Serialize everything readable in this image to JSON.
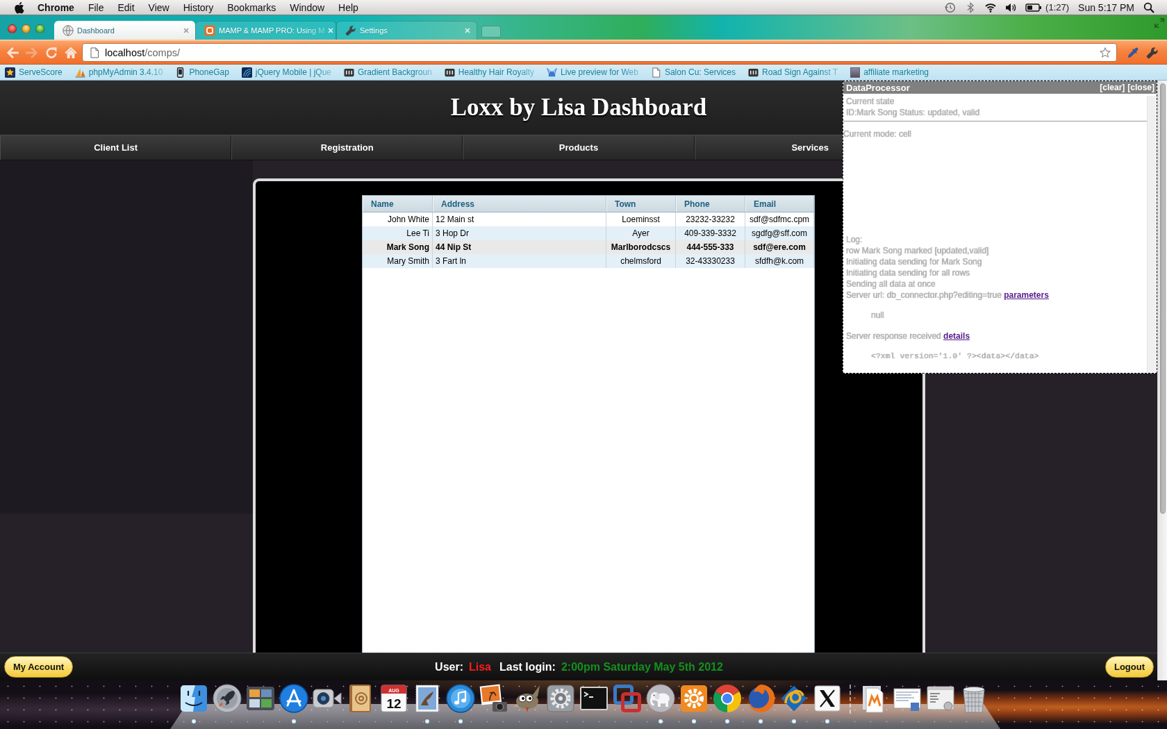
{
  "menu_bar": {
    "app_name": "Chrome",
    "menus": [
      "File",
      "Edit",
      "View",
      "History",
      "Bookmarks",
      "Window",
      "Help"
    ],
    "battery_time": "(1:27)",
    "clock": "Sun 5:17 PM"
  },
  "browser": {
    "tabs": [
      {
        "kind": "page",
        "title": "Dashboard",
        "selected": true,
        "truncated": false
      },
      {
        "kind": "blog",
        "title": "MAMP & MAMP PRO: Using M",
        "selected": false,
        "truncated": true
      },
      {
        "kind": "settings",
        "title": "Settings",
        "selected": false,
        "truncated": false
      }
    ],
    "nav_buttons": [
      {
        "kind": "back",
        "disabled": false
      },
      {
        "kind": "forward",
        "disabled": true
      },
      {
        "kind": "reload",
        "disabled": false
      },
      {
        "kind": "home",
        "disabled": false
      }
    ],
    "url": {
      "host": "localhost",
      "path": "/comps/"
    },
    "bookmarks": [
      {
        "kind": "star",
        "label": "ServeScore",
        "truncated": false
      },
      {
        "kind": "sail",
        "label": "phpMyAdmin 3.4.10",
        "truncated": true
      },
      {
        "kind": "phone",
        "label": "PhoneGap",
        "truncated": false
      },
      {
        "kind": "swirl",
        "label": "jQuery Mobile | jQue",
        "truncated": true
      },
      {
        "kind": "tile",
        "label": "Gradient Backgroun",
        "truncated": true
      },
      {
        "kind": "tile",
        "label": "Healthy Hair Royalty",
        "truncated": true
      },
      {
        "kind": "helmet",
        "label": "Live preview for Web",
        "truncated": true
      },
      {
        "kind": "page",
        "label": "Salon Cu: Services",
        "truncated": false
      },
      {
        "kind": "tile",
        "label": "Road Sign Against T",
        "truncated": true
      },
      {
        "kind": "photo",
        "label": "affiliate marketing",
        "truncated": false
      }
    ]
  },
  "page": {
    "title": "Loxx by Lisa Dashboard",
    "nav": [
      "Client List",
      "Registration",
      "Products",
      "Services"
    ],
    "grid": {
      "columns": [
        "Name",
        "Address",
        "Town",
        "Phone",
        "Email"
      ],
      "rows": [
        {
          "cells": [
            "John White",
            "12 Main st",
            "Loeminsst",
            "23232-33232",
            "sdf@sdfmc.cpm"
          ],
          "selected": false,
          "updated": false
        },
        {
          "cells": [
            "Lee Ti",
            "3 Hop Dr",
            "Ayer",
            "409-339-3332",
            "sgdfg@sff.com"
          ],
          "selected": false,
          "updated": false
        },
        {
          "cells": [
            "Mark Song",
            "44 Nip St",
            "Marlborodcscs",
            "444-555-333",
            "sdf@ere.com"
          ],
          "selected": true,
          "updated": true
        },
        {
          "cells": [
            "Mary Smith",
            "3 Fart ln",
            "chelmsford",
            "32-43330233",
            "sfdfh@k.com"
          ],
          "selected": false,
          "updated": false
        }
      ]
    },
    "footer": {
      "account_button": "My Account",
      "user_label": "User:",
      "user_name": "Lisa",
      "last_login_label": "Last login:",
      "last_login": "2:00pm Saturday May 5th 2012",
      "logout_button": "Logout"
    }
  },
  "debug_panel": {
    "title": "DataProcessor",
    "actions": [
      "[clear]",
      "[close]"
    ],
    "state_heading": "Current state",
    "state": "ID:Mark Song Status: updated, valid",
    "mode": "Current mode: cell",
    "log": [
      {
        "kind": "text",
        "text": "Log:"
      },
      {
        "kind": "text",
        "text": "row Mark Song marked [updated,valid]"
      },
      {
        "kind": "text",
        "text": "Initiating data sending for Mark Song"
      },
      {
        "kind": "text",
        "text": "Initiating data sending for all rows"
      },
      {
        "kind": "text",
        "text": "Sending all data at once"
      },
      {
        "kind": "link",
        "text": "Server url: db_connector.php?editing=true",
        "link": "parameters"
      },
      {
        "kind": "output",
        "text": "null"
      },
      {
        "kind": "link",
        "text": "Server response received",
        "link": "details"
      },
      {
        "kind": "code",
        "text": "<?xml version='1.0' ?><data></data>"
      }
    ]
  },
  "dock": {
    "apps": [
      {
        "kind": "face",
        "running": true
      },
      {
        "kind": "rocket",
        "running": false
      },
      {
        "kind": "window_grid",
        "running": false
      },
      {
        "kind": "app_store",
        "running": true
      },
      {
        "kind": "camera",
        "running": false
      },
      {
        "kind": "address_book",
        "running": false
      },
      {
        "kind": "calendar",
        "running": false,
        "month": "AUG",
        "day": "12"
      },
      {
        "kind": "stamp",
        "running": true
      },
      {
        "kind": "music",
        "running": true
      },
      {
        "kind": "photo_camera",
        "running": false
      },
      {
        "kind": "mascot",
        "running": false
      },
      {
        "kind": "settings",
        "running": false
      },
      {
        "kind": "terminal",
        "running": false
      },
      {
        "kind": "squares",
        "running": false
      },
      {
        "kind": "elephant",
        "running": true
      },
      {
        "kind": "gear_tile",
        "running": true
      },
      {
        "kind": "browser",
        "running": true
      },
      {
        "kind": "fox_globe",
        "running": true
      },
      {
        "kind": "knot",
        "running": true
      },
      {
        "kind": "x_logo",
        "running": true
      }
    ],
    "stacks": [
      {
        "kind": "document_stack"
      },
      {
        "kind": "screenshot"
      },
      {
        "kind": "window_document"
      },
      {
        "kind": "trash"
      }
    ]
  }
}
